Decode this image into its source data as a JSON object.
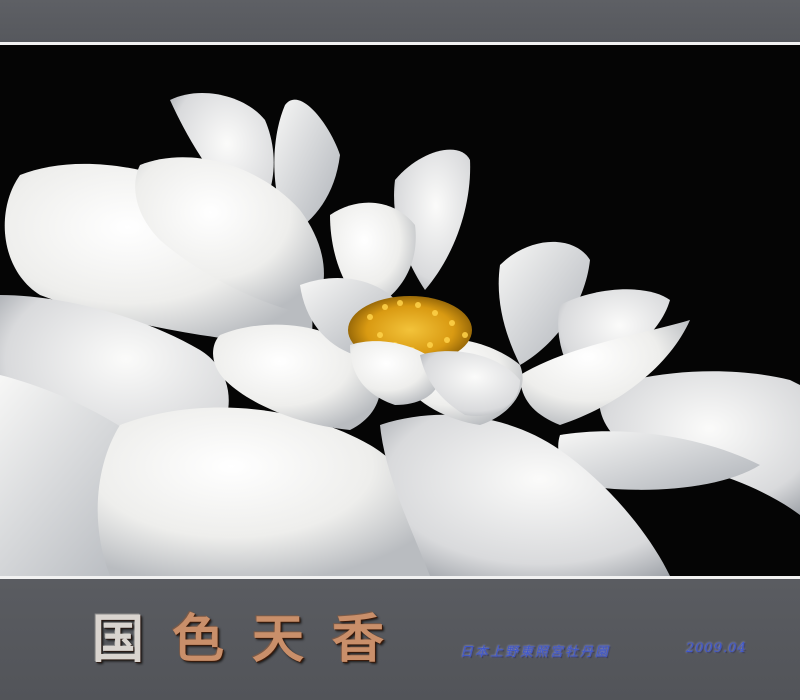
{
  "footer": {
    "title_chars": [
      "国",
      "色",
      "天",
      "香"
    ],
    "caption": "日本上野東照宮牡丹園",
    "date": "2009.04"
  },
  "colors": {
    "band": "#5b5d62",
    "rule": "#f2f2f2",
    "photo_background": "#050505",
    "petal": "#f4f4f2",
    "stamen": "#e9b21c",
    "caption": "#3f57c9"
  },
  "image": {
    "subject": "white-peony-flower"
  }
}
